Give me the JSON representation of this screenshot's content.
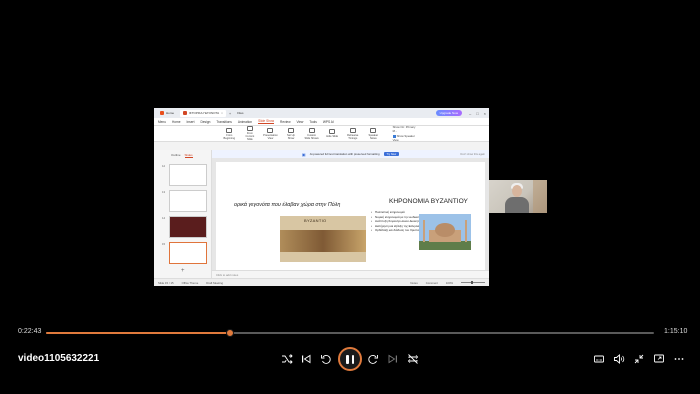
{
  "player": {
    "title": "video1105632221",
    "current_time": "0:22:43",
    "total_time": "1:15:10",
    "progress": 0.302,
    "accent": "#e07a3c"
  },
  "wps": {
    "tabs": [
      "Home",
      "ΙΣΤΟΡΙΚΑ ΓΕΓΟΝΟΤΑ",
      "Files"
    ],
    "upgrade": "Upgrade Now",
    "menu": [
      "Menu",
      "Home",
      "Insert",
      "Design",
      "Transitions",
      "Animation",
      "Slide Show",
      "Review",
      "View",
      "Tools",
      "WPS AI"
    ],
    "active_menu": "Slide Show",
    "ribbon": [
      {
        "label": "From Beginning"
      },
      {
        "label": "From Current Slide"
      },
      {
        "label": "Presentation View"
      },
      {
        "label": "Set Up Show"
      },
      {
        "label": "Custom Slide Shows"
      },
      {
        "label": "Hide Slide"
      },
      {
        "label": "Rehearse Timings"
      },
      {
        "label": "Speaker Notes"
      }
    ],
    "ribbon_group": {
      "monitor_label": "Show On:",
      "monitor_value": "Primary M...",
      "speaker_view": "Show Speaker View"
    },
    "banner": {
      "text": "AI-powered full text translation with preserved formatting",
      "button": "Try Now",
      "dismiss": "Don't show this again"
    },
    "panel_tabs": [
      "Outline",
      "Slides"
    ],
    "thumbnails": [
      {
        "num": "12"
      },
      {
        "num": "13"
      },
      {
        "num": "14"
      },
      {
        "num": "15"
      }
    ],
    "slide": {
      "left_heading": "ορικά γεγονότα που έλαβαν χώρα στην Πόλη",
      "image_caption": "ΒΥΖΑΝΤΙΟ",
      "title": "ΚΗΡΟΝΟΜΙΑ ΒΥΖΑΝΤΙΟΥ",
      "bullets": [
        "Πολιτιστική κληρονομιά",
        "Νομική κληρονομιά με την κωδικοποίηση του Ρωμαϊκού Δικαίου",
        "Ανάπτυξη Συγκεντρωτικού-Διοικητικού συστήματος",
        "Διατήρηση και εξέλιξη της Ελληνικής Γλώσσας",
        "Ορθόδοξη και διάδοση του Χριστιανισμού"
      ]
    },
    "notes_placeholder": "Click to add notes",
    "status": {
      "slide": "Slide 15 / 15",
      "theme": "Office Theme",
      "mode": "Draft Meeting",
      "notes": "Notes",
      "comment": "Comment",
      "zoom": "100%"
    }
  }
}
